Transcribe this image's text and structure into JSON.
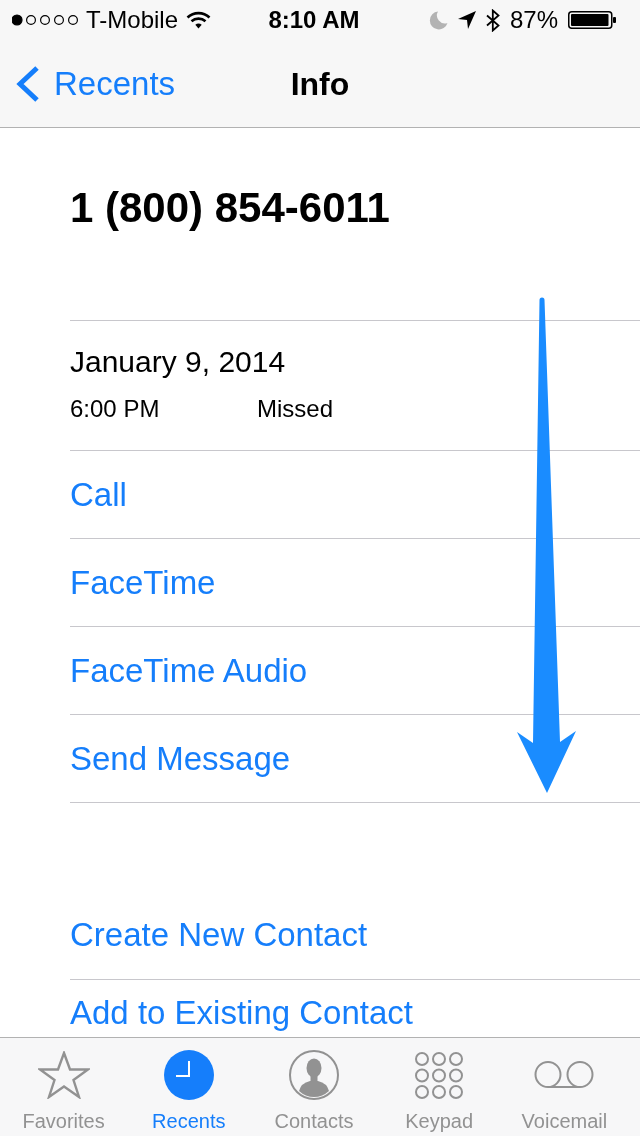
{
  "status_bar": {
    "carrier": "T-Mobile",
    "time": "8:10 AM",
    "battery": "87%"
  },
  "nav_bar": {
    "back": "Recents",
    "title": "Info"
  },
  "caller": {
    "number": "1 (800) 854-6011"
  },
  "call_log": {
    "date": "January 9, 2014",
    "entries": [
      {
        "time": "6:00 PM",
        "status": "Missed"
      }
    ]
  },
  "actions": [
    {
      "label": "Call"
    },
    {
      "label": "FaceTime"
    },
    {
      "label": "FaceTime Audio"
    },
    {
      "label": "Send Message"
    }
  ],
  "contact_actions": [
    {
      "label": "Create New Contact"
    },
    {
      "label": "Add to Existing Contact"
    }
  ],
  "tab_bar": [
    {
      "kind": "favorites",
      "label": "Favorites",
      "selected": false
    },
    {
      "kind": "recents",
      "label": "Recents",
      "selected": true
    },
    {
      "kind": "contacts",
      "label": "Contacts",
      "selected": false
    },
    {
      "kind": "keypad",
      "label": "Keypad",
      "selected": false
    },
    {
      "kind": "voicemail",
      "label": "Voicemail",
      "selected": false
    }
  ]
}
